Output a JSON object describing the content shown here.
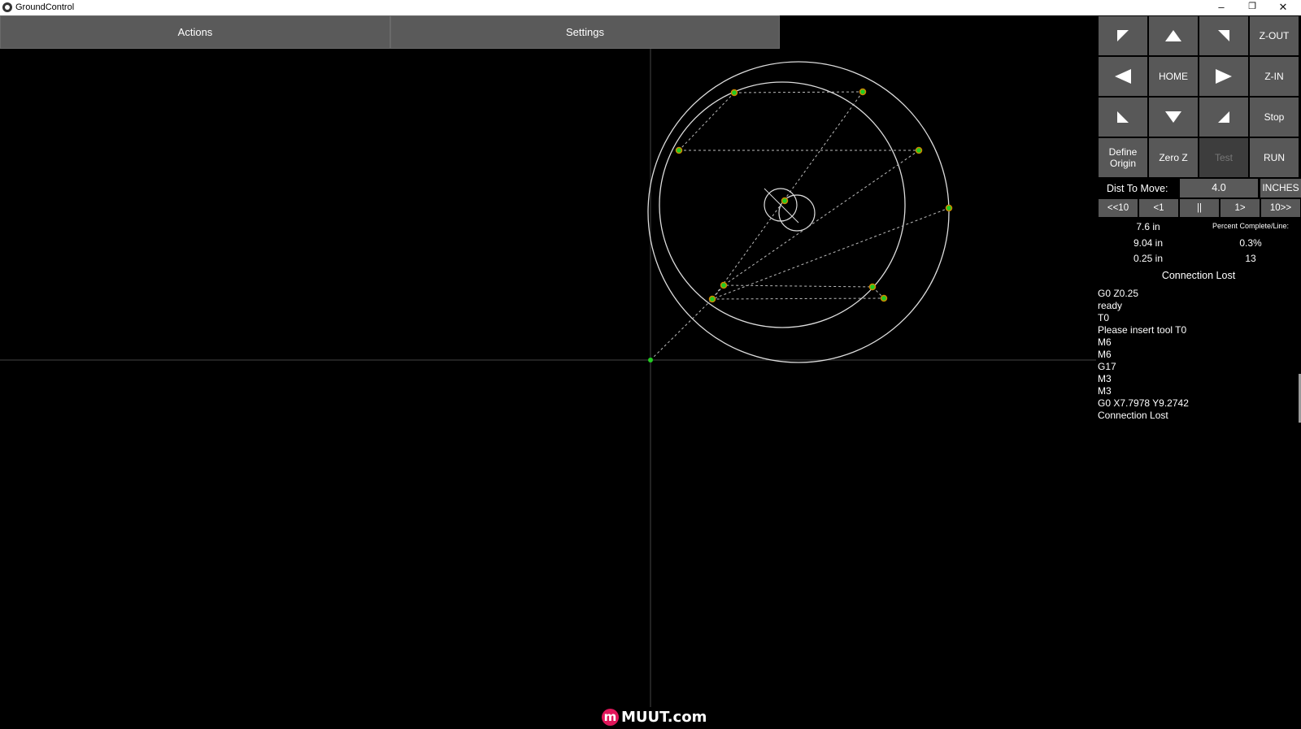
{
  "window": {
    "title": "GroundControl",
    "controls": {
      "minimize": "–",
      "restore": "❐",
      "close": "✕"
    }
  },
  "menu": {
    "actions_label": "Actions",
    "settings_label": "Settings"
  },
  "jog": {
    "zout_label": "Z-OUT",
    "home_label": "HOME",
    "zin_label": "Z-IN",
    "stop_label": "Stop",
    "define_origin_label": "Define Origin",
    "zero_z_label": "Zero Z",
    "test_label": "Test",
    "run_label": "RUN"
  },
  "dist": {
    "label": "Dist To Move:",
    "value": "4.0",
    "units": "INCHES"
  },
  "playback": {
    "back10": "<<10",
    "back1": "<1",
    "pause": "||",
    "fwd1": "1>",
    "fwd10": "10>>"
  },
  "position": {
    "x": "7.6 in",
    "y": "9.04 in",
    "z": "0.25 in"
  },
  "progress": {
    "label": "Percent Complete/Line:",
    "percent": "0.3%",
    "line": "13"
  },
  "status": "Connection Lost",
  "console_lines": [
    "G0 Z0.25",
    "ready",
    "T0",
    "Please insert tool T0",
    "M6",
    "M6",
    "G17",
    "M3",
    "M3",
    "G0 X7.7978 Y9.2742",
    "Connection Lost"
  ],
  "watermark": {
    "logo_letter": "m",
    "text": "MUUT.com"
  },
  "colors": {
    "panel_button": "#585858",
    "point_fill": "#22cc22",
    "point_ring": "#cc8800",
    "canvas_bg": "#000000"
  }
}
